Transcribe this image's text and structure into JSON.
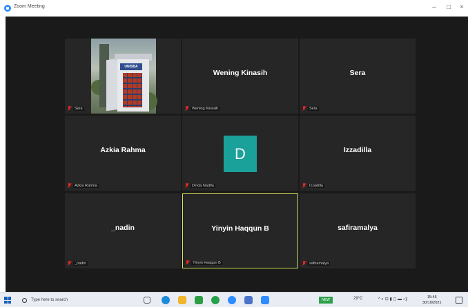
{
  "window": {
    "title": "Zoom Meeting"
  },
  "tiles": [
    {
      "display_name": "",
      "label": "Sera",
      "muted": true
    },
    {
      "display_name": "Wening Kinasih",
      "label": "Wening Kinasih",
      "muted": true
    },
    {
      "display_name": "Sera",
      "label": "Sera",
      "muted": true
    },
    {
      "display_name": "Azkia Rahma",
      "label": "Azkia Rahma",
      "muted": true
    },
    {
      "display_name": "",
      "label": "Dinda Nadifa",
      "avatar_letter": "D",
      "muted": true
    },
    {
      "display_name": "Izzadilla",
      "label": "Izzadilla",
      "muted": true
    },
    {
      "display_name": "_nadin",
      "label": "_nadin",
      "muted": true
    },
    {
      "display_name": "Yinyin Haqqun B",
      "label": "Yinyin Haqqun B",
      "muted": true,
      "active_speaker": true
    },
    {
      "display_name": "safiramalya",
      "label": "safiramalya",
      "muted": true
    }
  ],
  "photo_sign": "UNISBA",
  "taskbar": {
    "search_placeholder": "Type here to search",
    "weather": "29°C",
    "time": "15:46",
    "date": "30/10/2021",
    "badge": "NEW"
  },
  "colors": {
    "meeting_bg": "#1a1a1a",
    "tile_bg": "#262626",
    "active_border": "#d8e35b",
    "avatar_bg": "#1aa199",
    "mute_red": "#e02828"
  }
}
